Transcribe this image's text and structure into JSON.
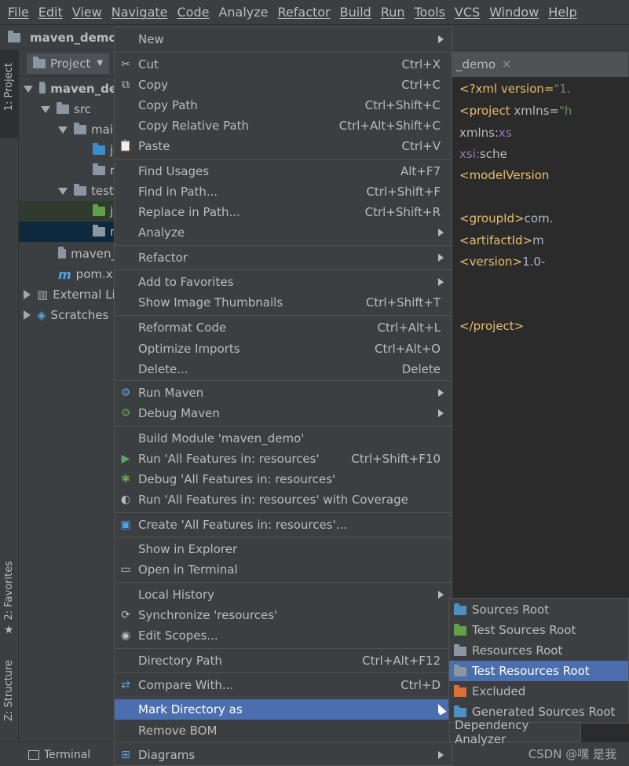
{
  "menubar": [
    "File",
    "Edit",
    "View",
    "Navigate",
    "Code",
    "Analyze",
    "Refactor",
    "Build",
    "Run",
    "Tools",
    "VCS",
    "Window",
    "Help"
  ],
  "navbar": {
    "project": "maven_demo"
  },
  "stripe": {
    "project": "1: Project",
    "favorites": "2: Favorites",
    "structure": "Z: Structure"
  },
  "project_panel": {
    "selector": "Project",
    "tree": [
      {
        "label": "maven_de",
        "bold": true
      },
      {
        "label": "src"
      },
      {
        "label": "mai"
      },
      {
        "label": "j"
      },
      {
        "label": "r"
      },
      {
        "label": "test"
      },
      {
        "label": "j"
      },
      {
        "label": "r"
      },
      {
        "label": "maven_"
      },
      {
        "label": "pom.xi"
      },
      {
        "label": "External Li"
      },
      {
        "label": "Scratches"
      }
    ]
  },
  "editor": {
    "tab": "_demo",
    "lines": [
      {
        "a": "<?xml version=",
        "b": "\"1."
      },
      {
        "a": "<project ",
        "b": "xmlns=",
        "c": "\"h"
      },
      {
        "a": "        xmlns:",
        "b": "xs"
      },
      {
        "a": "        xsi:",
        "b": "sche"
      },
      {
        "a": "    <modelVersion"
      },
      {
        "a": "    <groupId>",
        "b": "com."
      },
      {
        "a": "    <artifactId>",
        "b": "m"
      },
      {
        "a": "    <version>",
        "b": "1.0-"
      },
      {
        "a": "</project>"
      }
    ]
  },
  "context_menu": [
    {
      "label": "New",
      "submenu": true
    },
    {
      "label": "Cut",
      "shortcut": "Ctrl+X",
      "icon": "scissors-icon"
    },
    {
      "label": "Copy",
      "shortcut": "Ctrl+C",
      "icon": "copy-icon"
    },
    {
      "label": "Copy Path",
      "shortcut": "Ctrl+Shift+C"
    },
    {
      "label": "Copy Relative Path",
      "shortcut": "Ctrl+Alt+Shift+C"
    },
    {
      "label": "Paste",
      "shortcut": "Ctrl+V",
      "icon": "paste-icon"
    },
    {
      "label": "Find Usages",
      "shortcut": "Alt+F7"
    },
    {
      "label": "Find in Path...",
      "shortcut": "Ctrl+Shift+F"
    },
    {
      "label": "Replace in Path...",
      "shortcut": "Ctrl+Shift+R"
    },
    {
      "label": "Analyze",
      "submenu": true
    },
    {
      "label": "Refactor",
      "submenu": true
    },
    {
      "label": "Add to Favorites",
      "submenu": true
    },
    {
      "label": "Show Image Thumbnails",
      "shortcut": "Ctrl+Shift+T"
    },
    {
      "label": "Reformat Code",
      "shortcut": "Ctrl+Alt+L"
    },
    {
      "label": "Optimize Imports",
      "shortcut": "Ctrl+Alt+O"
    },
    {
      "label": "Delete...",
      "shortcut": "Delete"
    },
    {
      "label": "Run Maven",
      "submenu": true,
      "icon": "maven-gear-icon"
    },
    {
      "label": "Debug Maven",
      "submenu": true,
      "icon": "maven-debug-icon"
    },
    {
      "label": "Build Module 'maven_demo'"
    },
    {
      "label": "Run 'All Features in: resources'",
      "shortcut": "Ctrl+Shift+F10",
      "icon": "run-icon"
    },
    {
      "label": "Debug 'All Features in: resources'",
      "icon": "debug-icon"
    },
    {
      "label": "Run 'All Features in: resources' with Coverage",
      "icon": "coverage-icon"
    },
    {
      "label": "Create 'All Features in: resources'...",
      "icon": "create-config-icon"
    },
    {
      "label": "Show in Explorer"
    },
    {
      "label": "Open in Terminal",
      "icon": "terminal-icon"
    },
    {
      "label": "Local History",
      "submenu": true
    },
    {
      "label": "Synchronize 'resources'",
      "icon": "sync-icon"
    },
    {
      "label": "Edit Scopes...",
      "icon": "scope-icon"
    },
    {
      "label": "Directory Path",
      "shortcut": "Ctrl+Alt+F12"
    },
    {
      "label": "Compare With...",
      "shortcut": "Ctrl+D",
      "icon": "compare-icon"
    },
    {
      "label": "Mark Directory as",
      "submenu": true
    },
    {
      "label": "Remove BOM"
    },
    {
      "label": "Diagrams",
      "submenu": true,
      "icon": "diagram-icon"
    }
  ],
  "mark_submenu": [
    {
      "label": "Sources Root"
    },
    {
      "label": "Test Sources Root"
    },
    {
      "label": "Resources Root"
    },
    {
      "label": "Test Resources Root"
    },
    {
      "label": "Excluded"
    },
    {
      "label": "Generated Sources Root"
    }
  ],
  "tooltip": "Dependency Analyzer",
  "bottom": {
    "terminal": "Terminal",
    "watermark": "CSDN @嘿 是我"
  },
  "colors": {
    "highlight": "#4b6eaf",
    "menu_bg": "#3c3f41",
    "editor_bg": "#2b2b2b",
    "tag": "#e8bf6a",
    "string": "#6a8759"
  }
}
